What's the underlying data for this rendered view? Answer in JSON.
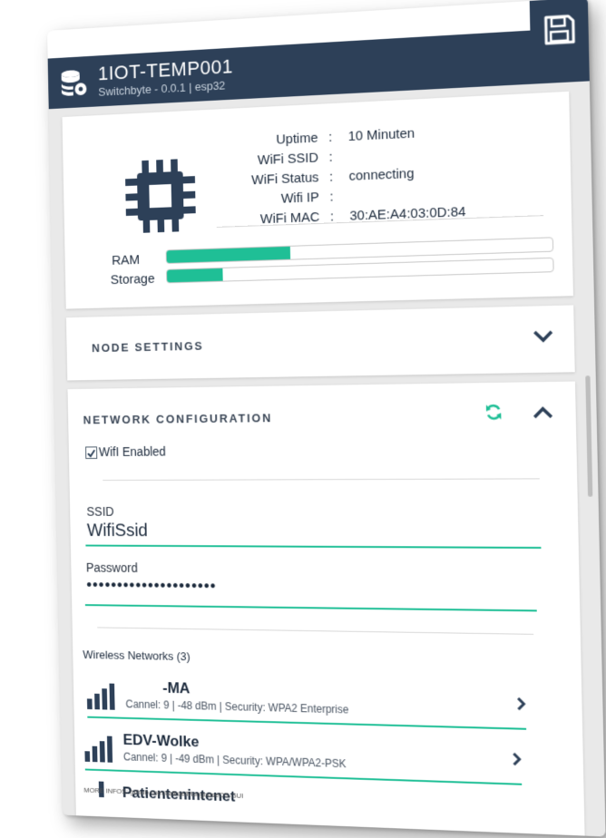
{
  "header": {
    "title": "1IOT-TEMP001",
    "subtitle": "Switchbyte - 0.0.1 | esp32",
    "icon": "database-gear-icon",
    "save_icon": "floppy-disk-icon",
    "color": "#2d4058"
  },
  "status": {
    "rows": [
      {
        "key": "Uptime",
        "value": "10 Minuten"
      },
      {
        "key": "WiFi SSID",
        "value": ""
      },
      {
        "key": "WiFi Status",
        "value": "connecting"
      },
      {
        "key": "Wifi IP",
        "value": ""
      },
      {
        "key": "WiFi MAC",
        "value": "30:AE:A4:03:0D:84"
      }
    ],
    "ram_label": "RAM",
    "storage_label": "Storage",
    "ram_usage": 0.33,
    "storage_usage": 0.15,
    "accent": "#1fbf96"
  },
  "node_settings": {
    "title": "NODE SETTINGS",
    "icon": "chevron-down-icon"
  },
  "network": {
    "title": "NETWORK CONFIGURATION",
    "refresh_icon": "refresh-icon",
    "collapse_icon": "chevron-up-icon",
    "wifi_enabled_label": "WifI Enabled",
    "wifi_enabled": true,
    "ssid_label": "SSID",
    "ssid_value": "WifiSsid",
    "password_label": "Password",
    "password_value": "•••••••••••••••••••••",
    "networks_label": "Wireless Networks (3)",
    "networks": [
      {
        "name": "-MA",
        "meta": "Cannel: 9 | -48 dBm | Security: WPA2 Enterprise"
      },
      {
        "name": "EDV-Wolke",
        "meta": "Cannel: 9 | -49 dBm | Security: WPA/WPA2-PSK"
      },
      {
        "name": "Patientenintenet",
        "meta": ""
      }
    ]
  },
  "footer": {
    "text": "MORE INFOS: github.com/calkoe/MongooseOS-GUI"
  }
}
